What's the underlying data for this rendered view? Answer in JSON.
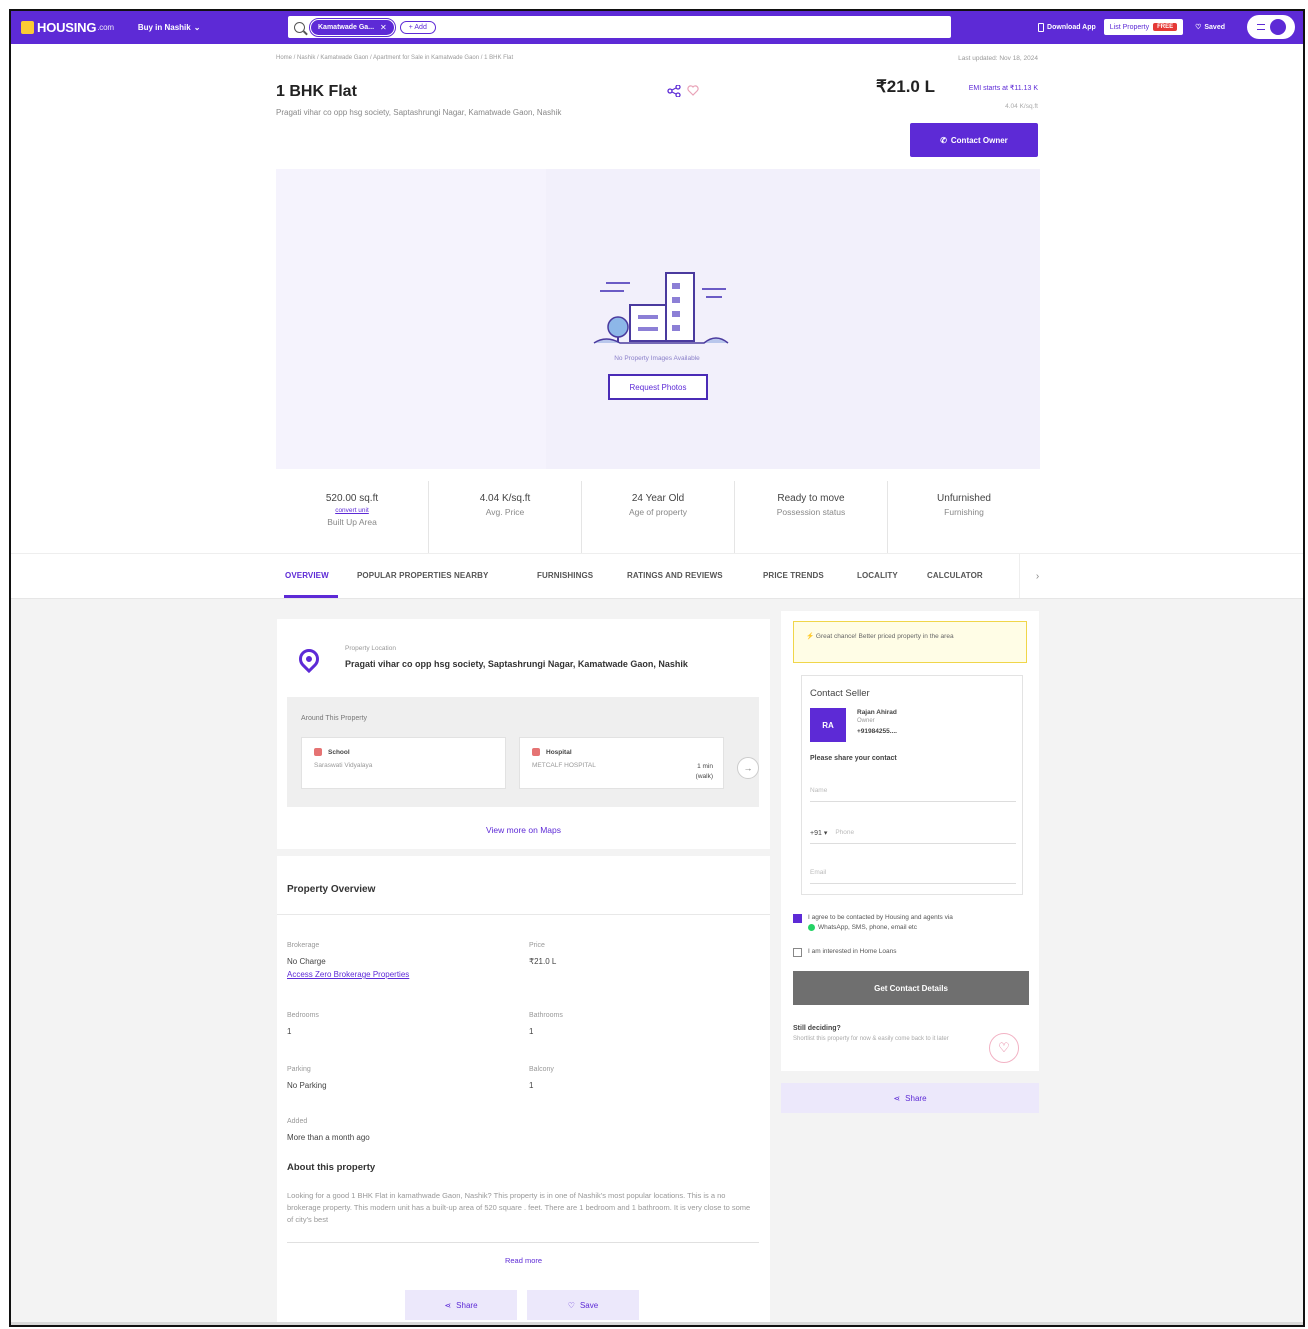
{
  "colors": {
    "brand": "#5d2ad6",
    "accent_free": "#e53935",
    "notice_border": "#f0d64a"
  },
  "header": {
    "logo_text": "HOUSING",
    "logo_suffix": ".com",
    "city_dropdown": "Buy in Nashik",
    "search_chip": "Kamatwade Ga...",
    "add_chip": "+ Add",
    "download_app": "Download App",
    "list_property": "List Property",
    "free_badge": "FREE",
    "saved": "Saved"
  },
  "breadcrumb": "Home / Nashik / Kamatwade Gaon / Apartment for Sale in Kamatwade Gaon / 1 BHK Flat",
  "last_updated": "Last updated: Nov 18, 2024",
  "property": {
    "title": "1 BHK Flat",
    "address": "Pragati vihar co opp hsg society, Saptashrungi Nagar, Kamatwade Gaon, Nashik",
    "price": "₹21.0 L",
    "emi": "EMI starts at ₹11.13 K",
    "price_per_sqft": "4.04 K/sq.ft",
    "contact_owner": "Contact Owner"
  },
  "gallery": {
    "no_photo_text": "No Property Images Available",
    "request_button": "Request Photos"
  },
  "stats": [
    {
      "value": "520.00 sq.ft",
      "extra": "convert unit",
      "label": "Built Up Area"
    },
    {
      "value": "4.04 K/sq.ft",
      "label": "Avg. Price"
    },
    {
      "value": "24 Year Old",
      "label": "Age of property"
    },
    {
      "value": "Ready to move",
      "label": "Possession status"
    },
    {
      "value": "Unfurnished",
      "label": "Furnishing"
    }
  ],
  "tabs": [
    "OVERVIEW",
    "POPULAR PROPERTIES NEARBY",
    "FURNISHINGS",
    "RATINGS AND REVIEWS",
    "PRICE TRENDS",
    "LOCALITY",
    "CALCULATOR"
  ],
  "location": {
    "label": "Property Location",
    "value": "Pragati vihar co opp hsg society, Saptashrungi Nagar, Kamatwade Gaon, Nashik",
    "around_heading": "Around This Property",
    "pois": [
      {
        "type": "School",
        "name": "Saraswati Vidyalaya",
        "distance": ""
      },
      {
        "type": "Hospital",
        "name": "METCALF HOSPITAL",
        "distance": "1 min",
        "mode": "(walk)"
      }
    ],
    "maps_link": "View more on Maps"
  },
  "overview": {
    "title": "Property Overview",
    "items": [
      {
        "key": "Brokerage",
        "value": "No Charge"
      },
      {
        "key": "Price",
        "value": "₹21.0 L"
      },
      {
        "key": "Bedrooms",
        "value": "1"
      },
      {
        "key": "Bathrooms",
        "value": "1"
      },
      {
        "key": "Parking",
        "value": "No Parking"
      },
      {
        "key": "Balcony",
        "value": "1"
      },
      {
        "key": "Added",
        "value": "More than a month ago"
      }
    ],
    "zero_brokerage_link": "Access Zero Brokerage Properties",
    "about_heading": "About this property",
    "about_text": "Looking for a good 1 BHK Flat in kamathwade Gaon, Nashik? This property is in one of Nashik's most popular locations. This is a no brokerage property. This modern unit has a built-up area of 520 square . feet. There are 1 bedroom and 1 bathroom. It is very close to some of city's best",
    "read_more": "Read more",
    "share": "Share",
    "save": "Save"
  },
  "seller": {
    "notice": "Great chance! Better priced property in the area",
    "heading": "Contact Seller",
    "initials": "RA",
    "name": "Rajan Ahirad",
    "role": "Owner",
    "phone": "+91984255....",
    "prompt": "Please share your contact",
    "name_placeholder": "Name",
    "country_code": "+91",
    "phone_placeholder": "Phone",
    "email_placeholder": "Email",
    "consent": "I agree to be contacted by Housing and agents via",
    "consent2": "WhatsApp, SMS, phone, email etc",
    "loan": "I am interested in Home Loans",
    "get_details": "Get Contact Details",
    "still_h": "Still deciding?",
    "still_t": "Shortlist this property for now & easily come back to it later",
    "share": "Share"
  }
}
